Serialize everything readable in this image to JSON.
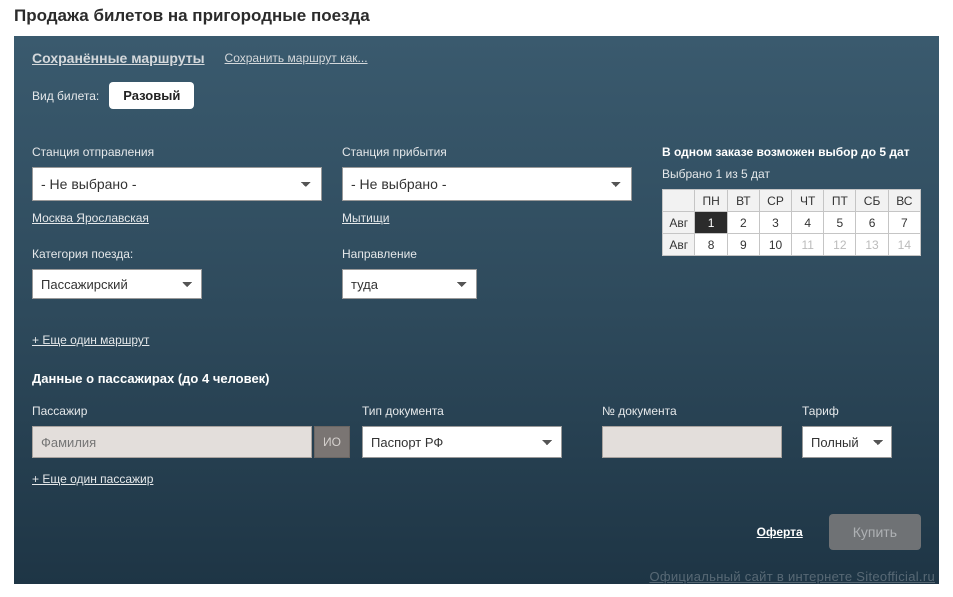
{
  "page": {
    "title": "Продажа билетов на пригородные поезда"
  },
  "top": {
    "saved_routes": "Сохранённые маршруты",
    "save_as": "Сохранить маршрут как..."
  },
  "ticket_type": {
    "label": "Вид билета:",
    "value": "Разовый"
  },
  "departure": {
    "label": "Станция отправления",
    "selected": "- Не выбрано -",
    "suggest": "Москва Ярославская"
  },
  "arrival": {
    "label": "Станция прибытия",
    "selected": "- Не выбрано -",
    "suggest": "Мытищи"
  },
  "category": {
    "label": "Категория поезда:",
    "selected": "Пассажирский"
  },
  "direction": {
    "label": "Направление",
    "selected": "туда"
  },
  "calendar": {
    "hint": "В одном заказе возможен выбор до 5 дат",
    "selected_text": "Выбрано 1 из 5 дат",
    "weekdays": [
      "ПН",
      "ВТ",
      "СР",
      "ЧТ",
      "ПТ",
      "СБ",
      "ВС"
    ],
    "month_label": "Авг",
    "rows": [
      {
        "days": [
          "1",
          "2",
          "3",
          "4",
          "5",
          "6",
          "7"
        ],
        "selected_index": 0,
        "dim_from": 7
      },
      {
        "days": [
          "8",
          "9",
          "10",
          "11",
          "12",
          "13",
          "14"
        ],
        "selected_index": -1,
        "dim_from": 3
      }
    ]
  },
  "add_route": "+ Еще один маршрут",
  "passengers": {
    "title": "Данные о пассажирах (до 4 человек)",
    "col_passenger": "Пассажир",
    "col_doc_type": "Тип документа",
    "col_doc_num": "№ документа",
    "col_tariff": "Тариф",
    "surname_placeholder": "Фамилия",
    "io_label": "ИО",
    "doc_selected": "Паспорт РФ",
    "tariff_selected": "Полный",
    "add_passenger": "+ Еще один пассажир"
  },
  "footer": {
    "oferta": "Оферта",
    "buy": "Купить"
  },
  "watermark": "Официальный сайт в интернете Siteofficial.ru"
}
